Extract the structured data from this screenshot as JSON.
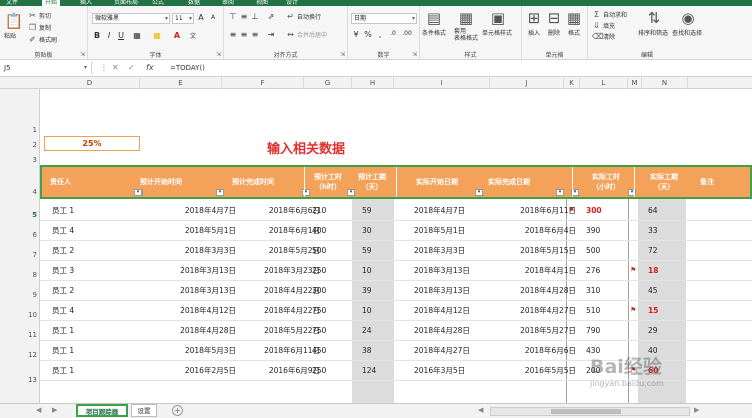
{
  "ribbon": {
    "tabs": [
      "文件",
      "开始",
      "插入",
      "页面布局",
      "公式",
      "数据",
      "审阅",
      "视图",
      "设计"
    ],
    "active_tab": "开始",
    "clipboard": {
      "cut": "剪切",
      "copy": "复制",
      "format_painter": "格式刷",
      "paste": "粘贴",
      "label": "剪贴板"
    },
    "font": {
      "name": "微软雅黑",
      "size": "11",
      "label": "字体"
    },
    "alignment": {
      "wrap": "自动换行",
      "merge": "合并后居中",
      "label": "对齐方式"
    },
    "number": {
      "format": "日期",
      "label": "数字"
    },
    "styles": {
      "conditional": "条件格式",
      "table": "套用\n表格格式",
      "cell_styles": "单元格样式",
      "label": "样式"
    },
    "cells": {
      "insert": "插入",
      "delete": "删除",
      "format": "格式",
      "label": "单元格"
    },
    "editing": {
      "autosum": "自动求和",
      "fill": "填充",
      "clear": "清除",
      "sort": "排序和筛选",
      "find": "查找和选择",
      "label": "编辑"
    }
  },
  "formula_bar": {
    "cell_ref": "J5",
    "formula": "=TODAY()"
  },
  "columns": [
    "D",
    "E",
    "F",
    "G",
    "H",
    "I",
    "J",
    "K",
    "L",
    "M",
    "N"
  ],
  "row_numbers": [
    "1",
    "2",
    "3",
    "4",
    "5",
    "6",
    "7",
    "8",
    "9",
    "10",
    "11",
    "12",
    "13"
  ],
  "percent_cell": "25%",
  "sheet_title": "输入相关数据",
  "table_headers": {
    "owner": "责任人",
    "plan_start": "预计开始时间",
    "plan_end": "预计完成时间",
    "plan_hours": "预计工时\n（h时）",
    "plan_days": "预计工期\n（天）",
    "actual_start": "实际开始日期",
    "actual_end": "实际完成日期",
    "actual_hours": "实际工时\n（小时）",
    "actual_days": "实际工期\n（天）",
    "remark": "备注"
  },
  "rows": [
    {
      "owner": "员工 1",
      "plan_start": "2018年4月7日",
      "plan_end": "2018年6月6日",
      "plan_hours": "210",
      "plan_days": "59",
      "actual_start": "2018年4月7日",
      "actual_end": "2018年6月11日",
      "actual_hours": "300",
      "actual_days": "64",
      "hours_flag": true,
      "days_flag": false
    },
    {
      "owner": "员工 4",
      "plan_start": "2018年5月1日",
      "plan_end": "2018年6月1日",
      "plan_hours": "400",
      "plan_days": "30",
      "actual_start": "2018年5月1日",
      "actual_end": "2018年6月4日",
      "actual_hours": "390",
      "actual_days": "33",
      "hours_flag": false,
      "days_flag": false
    },
    {
      "owner": "员工 2",
      "plan_start": "2018年3月3日",
      "plan_end": "2018年5月2日",
      "plan_hours": "500",
      "plan_days": "59",
      "actual_start": "2018年3月3日",
      "actual_end": "2018年5月15日",
      "actual_hours": "500",
      "actual_days": "72",
      "hours_flag": false,
      "days_flag": false
    },
    {
      "owner": "员工 3",
      "plan_start": "2018年3月13日",
      "plan_end": "2018年3月23日",
      "plan_hours": "250",
      "plan_days": "10",
      "actual_start": "2018年3月13日",
      "actual_end": "2018年4月1日",
      "actual_hours": "276",
      "actual_days": "18",
      "hours_flag": false,
      "days_flag": true
    },
    {
      "owner": "员工 2",
      "plan_start": "2018年3月13日",
      "plan_end": "2018年4月22日",
      "plan_hours": "300",
      "plan_days": "39",
      "actual_start": "2018年3月13日",
      "actual_end": "2018年4月28日",
      "actual_hours": "310",
      "actual_days": "45",
      "hours_flag": false,
      "days_flag": false
    },
    {
      "owner": "员工 4",
      "plan_start": "2018年4月12日",
      "plan_end": "2018年4月22日",
      "plan_hours": "750",
      "plan_days": "10",
      "actual_start": "2018年4月12日",
      "actual_end": "2018年4月27日",
      "actual_hours": "510",
      "actual_days": "15",
      "hours_flag": false,
      "days_flag": true
    },
    {
      "owner": "员工 1",
      "plan_start": "2018年4月28日",
      "plan_end": "2018年5月22日",
      "plan_hours": "750",
      "plan_days": "24",
      "actual_start": "2018年4月28日",
      "actual_end": "2018年5月27日",
      "actual_hours": "790",
      "actual_days": "29",
      "hours_flag": false,
      "days_flag": false
    },
    {
      "owner": "员工 1",
      "plan_start": "2018年5月3日",
      "plan_end": "2018年6月11日",
      "plan_hours": "450",
      "plan_days": "38",
      "actual_start": "2018年4月27日",
      "actual_end": "2018年6月6日",
      "actual_hours": "430",
      "actual_days": "40",
      "hours_flag": false,
      "days_flag": false
    },
    {
      "owner": "员工 1",
      "plan_start": "2016年2月5日",
      "plan_end": "2016年6月9日",
      "plan_hours": "250",
      "plan_days": "124",
      "actual_start": "2016年3月5日",
      "actual_end": "2016年5月5日",
      "actual_hours": "200",
      "actual_days": "60",
      "hours_flag": false,
      "days_flag": true
    }
  ],
  "sheet_tabs": [
    "项目跟踪器",
    "设置"
  ],
  "active_sheet": "项目跟踪器",
  "watermark": {
    "main": "Bai经验",
    "sub": "jingyan.baidu.com"
  },
  "colors": {
    "ribbon_green": "#217346",
    "header_orange": "#f4a25a",
    "highlight_green": "#3fa04a",
    "alert_red": "#d21f1f"
  }
}
